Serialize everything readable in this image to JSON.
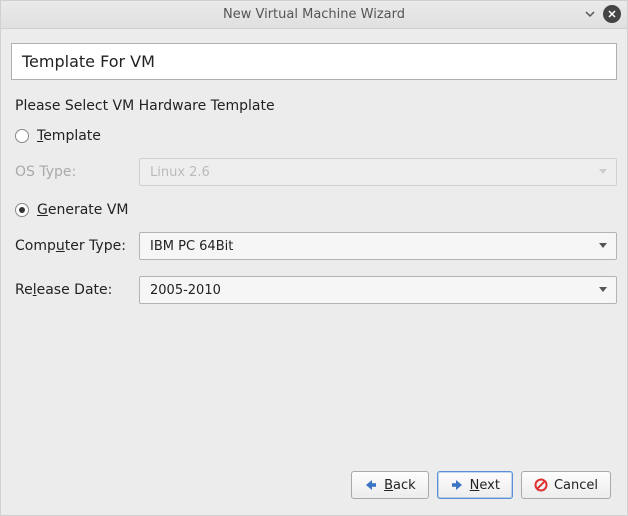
{
  "titlebar": {
    "title": "New Virtual Machine Wizard"
  },
  "page": {
    "title": "Template For VM",
    "section_label": "Please Select VM Hardware Template"
  },
  "radio_template": {
    "prefix": "T",
    "rest": "emplate"
  },
  "radio_generate": {
    "prefix": "G",
    "rest": "enerate VM"
  },
  "fields": {
    "os_type_label": "OS Type:",
    "os_type_value": "Linux 2.6",
    "computer_type_label_pre": "Comp",
    "computer_type_label_u": "u",
    "computer_type_label_post": "ter Type:",
    "computer_type_value": "IBM PC 64Bit",
    "release_date_label_pre": "Re",
    "release_date_label_u": "l",
    "release_date_label_post": "ease Date:",
    "release_date_value": "2005-2010"
  },
  "buttons": {
    "back_u": "B",
    "back_rest": "ack",
    "next_u": "N",
    "next_rest": "ext",
    "cancel": "Cancel"
  }
}
